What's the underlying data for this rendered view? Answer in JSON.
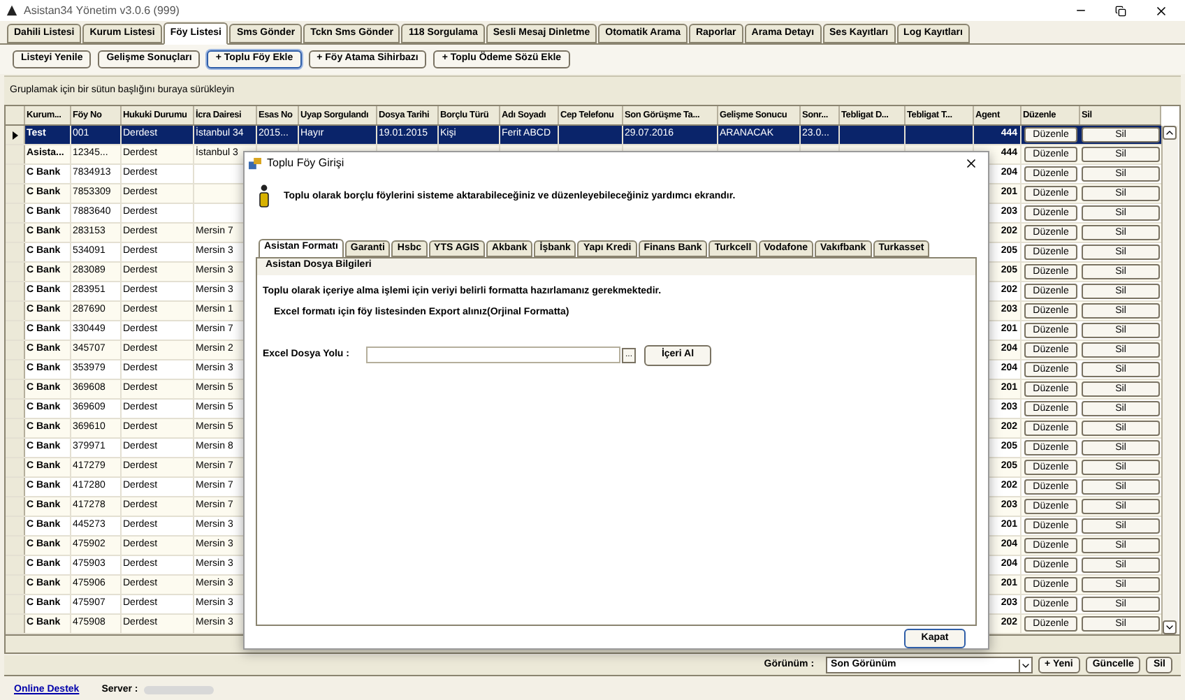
{
  "window": {
    "title": "Asistan34 Yönetim v3.0.6 (999)"
  },
  "tabs": [
    {
      "label": "Dahili Listesi",
      "selected": false
    },
    {
      "label": "Kurum Listesi",
      "selected": false
    },
    {
      "label": "Föy Listesi",
      "selected": true
    },
    {
      "label": "Sms Gönder",
      "selected": false
    },
    {
      "label": "Tckn Sms Gönder",
      "selected": false
    },
    {
      "label": "118 Sorgulama",
      "selected": false
    },
    {
      "label": "Sesli Mesaj Dinletme",
      "selected": false
    },
    {
      "label": "Otomatik Arama",
      "selected": false
    },
    {
      "label": "Raporlar",
      "selected": false
    },
    {
      "label": "Arama Detayı",
      "selected": false
    },
    {
      "label": "Ses Kayıtları",
      "selected": false
    },
    {
      "label": "Log Kayıtları",
      "selected": false
    }
  ],
  "toolbar": [
    {
      "label": "Listeyi Yenile",
      "focused": false
    },
    {
      "label": "Gelişme Sonuçları",
      "focused": false
    },
    {
      "label": "+ Toplu Föy Ekle",
      "focused": true
    },
    {
      "label": "+ Föy Atama Sihirbazı",
      "focused": false
    },
    {
      "label": "+ Toplu Ödeme Sözü Ekle",
      "focused": false
    }
  ],
  "group_hint": "Gruplamak için bir sütun başlığını buraya sürükleyin",
  "grid": {
    "columns": [
      "Kurum...",
      "Föy No",
      "Hukuki Durumu",
      "İcra Dairesi",
      "Esas No",
      "Uyap Sorgulandı",
      "Dosya Tarihi",
      "Borçlu Türü",
      "Adı Soyadı",
      "Cep Telefonu",
      "Son Görüşme Ta...",
      "Gelişme Sonucu",
      "Sonr...",
      "Tebligat D...",
      "Tebligat T...",
      "Agent",
      "Düzenle",
      "Sil"
    ],
    "rows": [
      {
        "selected": true,
        "cells": [
          "Test",
          "001",
          "Derdest",
          "İstanbul 34",
          "2015...",
          "Hayır",
          "19.01.2015",
          "Kişi",
          "Ferit ABCD",
          null,
          "29.07.2016",
          "ARANACAK",
          "23.0...",
          null,
          null
        ],
        "agent": "444",
        "edit": "Düzenle",
        "delete": "Sil"
      },
      {
        "selected": false,
        "cells": [
          "Asista...",
          "12345...",
          "Derdest",
          "İstanbul 3"
        ],
        "agent": "444",
        "edit": "Düzenle",
        "delete": "Sil"
      },
      {
        "selected": false,
        "cells": [
          "C Bank",
          "7834913",
          "Derdest"
        ],
        "agent": "204",
        "edit": "Düzenle",
        "delete": "Sil"
      },
      {
        "selected": false,
        "cells": [
          "C Bank",
          "7853309",
          "Derdest"
        ],
        "agent": "201",
        "edit": "Düzenle",
        "delete": "Sil"
      },
      {
        "selected": false,
        "cells": [
          "C Bank",
          "7883640",
          "Derdest"
        ],
        "agent": "203",
        "edit": "Düzenle",
        "delete": "Sil"
      },
      {
        "selected": false,
        "cells": [
          "C Bank",
          "283153",
          "Derdest",
          "Mersin 7"
        ],
        "agent": "202",
        "edit": "Düzenle",
        "delete": "Sil"
      },
      {
        "selected": false,
        "cells": [
          "C Bank",
          "534091",
          "Derdest",
          "Mersin 3"
        ],
        "agent": "205",
        "edit": "Düzenle",
        "delete": "Sil"
      },
      {
        "selected": false,
        "cells": [
          "C Bank",
          "283089",
          "Derdest",
          "Mersin 3"
        ],
        "agent": "205",
        "edit": "Düzenle",
        "delete": "Sil"
      },
      {
        "selected": false,
        "cells": [
          "C Bank",
          "283951",
          "Derdest",
          "Mersin 3"
        ],
        "agent": "202",
        "edit": "Düzenle",
        "delete": "Sil"
      },
      {
        "selected": false,
        "cells": [
          "C Bank",
          "287690",
          "Derdest",
          "Mersin 1"
        ],
        "agent": "203",
        "edit": "Düzenle",
        "delete": "Sil"
      },
      {
        "selected": false,
        "cells": [
          "C Bank",
          "330449",
          "Derdest",
          "Mersin 7"
        ],
        "agent": "201",
        "edit": "Düzenle",
        "delete": "Sil"
      },
      {
        "selected": false,
        "cells": [
          "C Bank",
          "345707",
          "Derdest",
          "Mersin 2"
        ],
        "agent": "204",
        "edit": "Düzenle",
        "delete": "Sil"
      },
      {
        "selected": false,
        "cells": [
          "C Bank",
          "353979",
          "Derdest",
          "Mersin 3"
        ],
        "agent": "204",
        "edit": "Düzenle",
        "delete": "Sil"
      },
      {
        "selected": false,
        "cells": [
          "C Bank",
          "369608",
          "Derdest",
          "Mersin 5"
        ],
        "agent": "201",
        "edit": "Düzenle",
        "delete": "Sil"
      },
      {
        "selected": false,
        "cells": [
          "C Bank",
          "369609",
          "Derdest",
          "Mersin 5"
        ],
        "agent": "203",
        "edit": "Düzenle",
        "delete": "Sil"
      },
      {
        "selected": false,
        "cells": [
          "C Bank",
          "369610",
          "Derdest",
          "Mersin 5"
        ],
        "agent": "202",
        "edit": "Düzenle",
        "delete": "Sil"
      },
      {
        "selected": false,
        "cells": [
          "C Bank",
          "379971",
          "Derdest",
          "Mersin 8"
        ],
        "agent": "205",
        "edit": "Düzenle",
        "delete": "Sil"
      },
      {
        "selected": false,
        "cells": [
          "C Bank",
          "417279",
          "Derdest",
          "Mersin 7"
        ],
        "agent": "205",
        "edit": "Düzenle",
        "delete": "Sil"
      },
      {
        "selected": false,
        "cells": [
          "C Bank",
          "417280",
          "Derdest",
          "Mersin 7"
        ],
        "agent": "202",
        "edit": "Düzenle",
        "delete": "Sil"
      },
      {
        "selected": false,
        "cells": [
          "C Bank",
          "417278",
          "Derdest",
          "Mersin 7"
        ],
        "agent": "203",
        "edit": "Düzenle",
        "delete": "Sil"
      },
      {
        "selected": false,
        "cells": [
          "C Bank",
          "445273",
          "Derdest",
          "Mersin 3"
        ],
        "agent": "201",
        "edit": "Düzenle",
        "delete": "Sil"
      },
      {
        "selected": false,
        "cells": [
          "C Bank",
          "475902",
          "Derdest",
          "Mersin 3"
        ],
        "agent": "204",
        "edit": "Düzenle",
        "delete": "Sil"
      },
      {
        "selected": false,
        "cells": [
          "C Bank",
          "475903",
          "Derdest",
          "Mersin 3"
        ],
        "agent": "204",
        "edit": "Düzenle",
        "delete": "Sil"
      },
      {
        "selected": false,
        "cells": [
          "C Bank",
          "475906",
          "Derdest",
          "Mersin 3"
        ],
        "agent": "201",
        "edit": "Düzenle",
        "delete": "Sil"
      },
      {
        "selected": false,
        "cells": [
          "C Bank",
          "475907",
          "Derdest",
          "Mersin 3"
        ],
        "agent": "203",
        "edit": "Düzenle",
        "delete": "Sil"
      },
      {
        "selected": false,
        "cells": [
          "C Bank",
          "475908",
          "Derdest",
          "Mersin 3"
        ],
        "agent": "202",
        "edit": "Düzenle",
        "delete": "Sil"
      }
    ]
  },
  "dialog": {
    "title": "Toplu Föy Girişi",
    "message": "Toplu olarak borçlu föylerini sisteme aktarabileceğiniz ve düzenleyebileceğiniz yardımcı ekrandır.",
    "tabs": [
      {
        "label": "Asistan Formatı",
        "selected": true
      },
      {
        "label": "Garanti",
        "selected": false
      },
      {
        "label": "Hsbc",
        "selected": false
      },
      {
        "label": "YTS AGIS",
        "selected": false
      },
      {
        "label": "Akbank",
        "selected": false
      },
      {
        "label": "İşbank",
        "selected": false
      },
      {
        "label": "Yapı Kredi",
        "selected": false
      },
      {
        "label": "Finans Bank",
        "selected": false
      },
      {
        "label": "Turkcell",
        "selected": false
      },
      {
        "label": "Vodafone",
        "selected": false
      },
      {
        "label": "Vakıfbank",
        "selected": false
      },
      {
        "label": "Turkasset",
        "selected": false
      }
    ],
    "section_title": "Asistan Dosya Bilgileri",
    "instruction": "Toplu olarak içeriye alma işlemi için veriyi belirli formatta hazırlamanız gerekmektedir.",
    "note": "Excel formatı için föy listesinden Export alınız(Orjinal Formatta)",
    "field_label": "Excel Dosya Yolu :",
    "browse_button": "...",
    "import_button": "İçeri Al",
    "close_button": "Kapat"
  },
  "view_bar": {
    "label": "Görünüm :",
    "value": "Son Görünüm",
    "buttons": [
      "+ Yeni",
      "Güncelle",
      "Sil"
    ]
  },
  "status_bar": {
    "link": "Online Destek",
    "server_label": "Server :"
  }
}
